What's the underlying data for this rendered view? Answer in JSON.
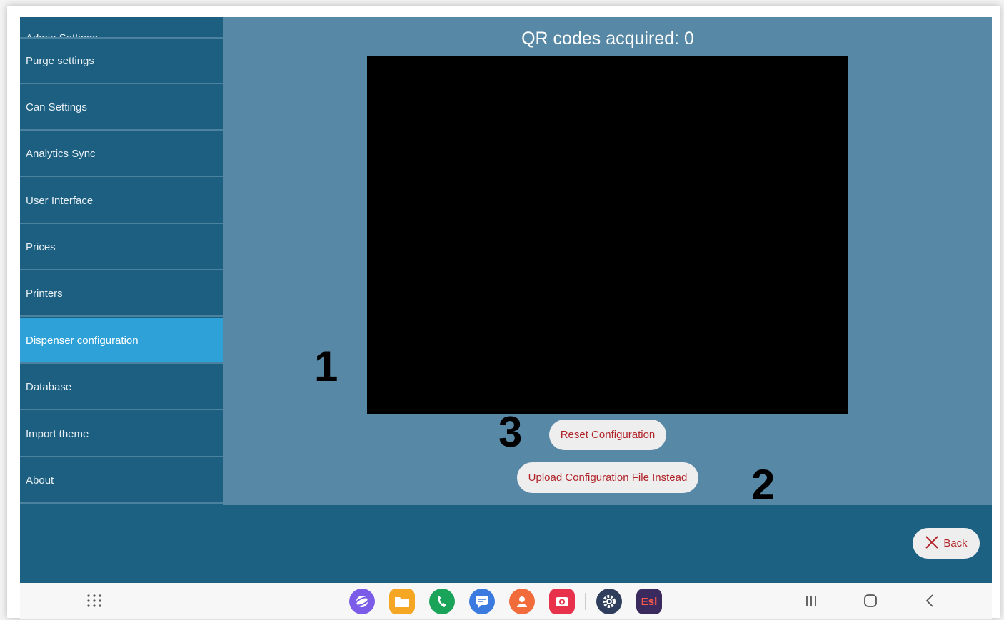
{
  "sidebar": {
    "items": [
      {
        "label": "Admin Settings"
      },
      {
        "label": "Purge settings"
      },
      {
        "label": "Can Settings"
      },
      {
        "label": "Analytics Sync"
      },
      {
        "label": "User Interface"
      },
      {
        "label": "Prices"
      },
      {
        "label": "Printers"
      },
      {
        "label": "Dispenser configuration"
      },
      {
        "label": "Database"
      },
      {
        "label": "Import theme"
      },
      {
        "label": "About"
      }
    ]
  },
  "main": {
    "title": "QR codes acquired: 0",
    "reset_button": "Reset Configuration",
    "upload_button": "Upload Configuration File Instead"
  },
  "annotations": {
    "marker_1": "1",
    "marker_2": "2",
    "marker_3": "3"
  },
  "footer": {
    "back_button": "Back"
  },
  "navbar": {
    "esl_badge": "Esl",
    "icons": [
      "apps-grid-icon",
      "browser-icon",
      "files-icon",
      "phone-icon",
      "messages-icon",
      "contacts-icon",
      "camera-app-icon",
      "settings-app-icon",
      "esl-app-icon",
      "recents-icon",
      "home-icon",
      "back-nav-icon"
    ]
  },
  "colors": {
    "sidebar_bg": "#1c5f80",
    "sidebar_active": "#2ea2d8",
    "content_bg": "#5788a6",
    "button_text": "#b1242a"
  }
}
